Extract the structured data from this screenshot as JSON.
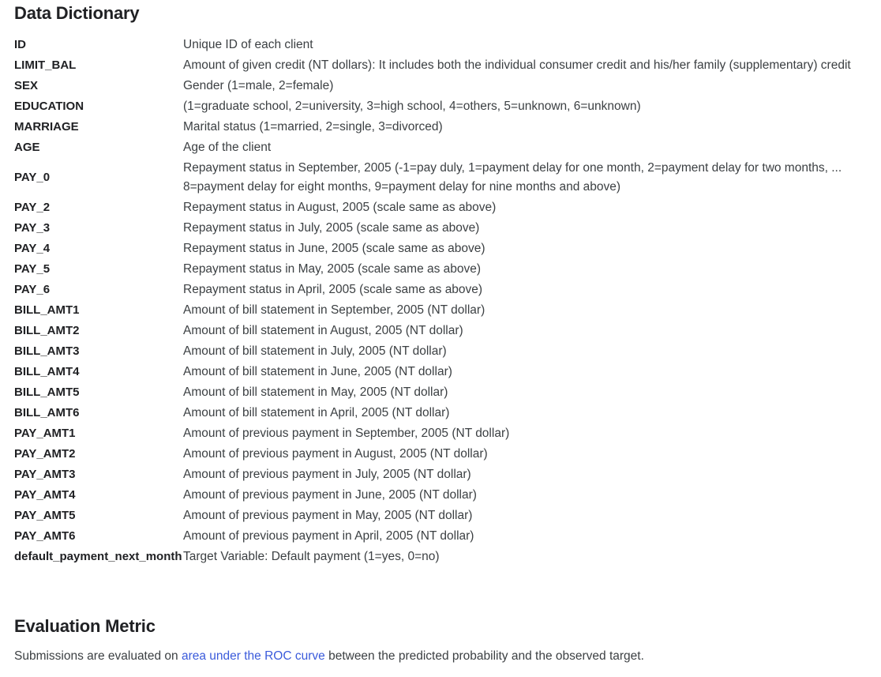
{
  "data_dictionary": {
    "title": "Data Dictionary",
    "rows": [
      {
        "name": "ID",
        "description": "Unique ID of each client"
      },
      {
        "name": "LIMIT_BAL",
        "description": "Amount of given credit (NT dollars):  It includes both the individual consumer credit and his/her family (supplementary) credit"
      },
      {
        "name": "SEX",
        "description": "Gender (1=male, 2=female)"
      },
      {
        "name": "EDUCATION",
        "description": "(1=graduate school, 2=university, 3=high school, 4=others, 5=unknown, 6=unknown)"
      },
      {
        "name": "MARRIAGE",
        "description": "Marital status (1=married, 2=single, 3=divorced)"
      },
      {
        "name": "AGE",
        "description": "Age of the client"
      },
      {
        "name": "PAY_0",
        "description": "Repayment status in September, 2005 (-1=pay duly, 1=payment delay for one month, 2=payment delay for two months, ... 8=payment delay for eight months, 9=payment delay for nine months and above)"
      },
      {
        "name": "PAY_2",
        "description": "Repayment status in August, 2005 (scale same as above)"
      },
      {
        "name": "PAY_3",
        "description": "Repayment status in July, 2005 (scale same as above)"
      },
      {
        "name": "PAY_4",
        "description": "Repayment status in June, 2005 (scale same as above)"
      },
      {
        "name": "PAY_5",
        "description": "Repayment status in May, 2005 (scale same as above)"
      },
      {
        "name": "PAY_6",
        "description": "Repayment status in April, 2005 (scale same as above)"
      },
      {
        "name": "BILL_AMT1",
        "description": "Amount of bill statement in September, 2005 (NT dollar)"
      },
      {
        "name": "BILL_AMT2",
        "description": "Amount of bill statement in August, 2005 (NT dollar)"
      },
      {
        "name": "BILL_AMT3",
        "description": "Amount of bill statement in July, 2005 (NT dollar)"
      },
      {
        "name": "BILL_AMT4",
        "description": "Amount of bill statement in June, 2005 (NT dollar)"
      },
      {
        "name": "BILL_AMT5",
        "description": "Amount of bill statement in May, 2005 (NT dollar)"
      },
      {
        "name": "BILL_AMT6",
        "description": "Amount of bill statement in April, 2005 (NT dollar)"
      },
      {
        "name": "PAY_AMT1",
        "description": "Amount of previous payment in September, 2005 (NT dollar)"
      },
      {
        "name": "PAY_AMT2",
        "description": "Amount of previous payment in August, 2005 (NT dollar)"
      },
      {
        "name": "PAY_AMT3",
        "description": "Amount of previous payment in July, 2005 (NT dollar)"
      },
      {
        "name": "PAY_AMT4",
        "description": "Amount of previous payment in June, 2005 (NT dollar)"
      },
      {
        "name": "PAY_AMT5",
        "description": "Amount of previous payment in May, 2005 (NT dollar)"
      },
      {
        "name": "PAY_AMT6",
        "description": "Amount of previous payment in April, 2005 (NT dollar)"
      },
      {
        "name": "default_payment_next_month",
        "description": "Target Variable: Default payment (1=yes, 0=no)"
      }
    ]
  },
  "evaluation_metric": {
    "title": "Evaluation Metric",
    "text_before": "Submissions are evaluated on ",
    "link_text": "area under the ROC curve",
    "text_after": " between the predicted probability and the observed target."
  },
  "colors": {
    "link": "#3b5bdb",
    "heading": "#202124",
    "body": "#3c4043"
  }
}
